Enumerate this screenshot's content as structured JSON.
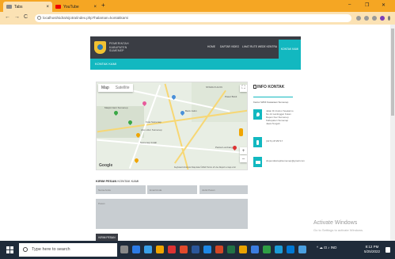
{
  "browser": {
    "tabs": [
      {
        "label": "Tabs",
        "active": true
      },
      {
        "label": "YouTube",
        "active": false
      }
    ],
    "new_tab": "+",
    "url": "localhost/sidra/sijotra/index.php?halaman=kontakkami",
    "window_controls": [
      "–",
      "❐",
      "✕"
    ]
  },
  "site": {
    "brand_lines": [
      "PEMERINTAH",
      "KABUPATEN",
      "SUMENEP"
    ],
    "nav": [
      "HOME",
      "DAFTAR VIDEO",
      "LIHAT RUTE WEDE KENTRA"
    ],
    "nav_cta": "KONTAK KAMI",
    "subtitle": "KONTAK KAMI"
  },
  "map": {
    "tab_map": "Map",
    "tab_satellite": "Satellite",
    "labels": [
      "STARA KULON",
      "Pasar Bukit",
      "Masjid Jami Sumenep",
      "Kota Sumenep",
      "Alun-Alun Sumenep",
      "Sumenep Indah",
      "Bank Jatim",
      "Pantai Lombang"
    ],
    "zoom_in": "+",
    "zoom_out": "–",
    "fullscreen": "⛶",
    "google": "Google",
    "attribution": "Keyboard shortcuts   Map data ©2022   Terms of Use   Report a map error"
  },
  "info": {
    "title": "INFO KONTAK",
    "description": "Kantor WIDI Kawaraan Sumenep",
    "address_lines": [
      "Jalan Dr.Insinur Soekarno",
      "No.14 Lantinggar Kotan",
      "Dapon Kec.Sumenep",
      "Kabupaten Sumenep",
      "Jawa Tengah"
    ],
    "phone": "(0271) 8725717",
    "email": "dispendukcapilsumenep@gmail.com"
  },
  "form": {
    "title_bold": "KIRIM PESAN",
    "title_rest": " KONTAK KAMI",
    "name_placeholder": "Nama Anda",
    "email_placeholder": "Email Anda",
    "subject_placeholder": "Judul Pesan",
    "message_placeholder": "Pesan",
    "send_label": "KIRIM PESAN"
  },
  "watermark": {
    "title": "Activate Windows",
    "subtitle": "Go to Settings to activate Windows."
  },
  "taskbar": {
    "search_placeholder": "Type here to search",
    "tray_text": "^ ☁ ⊡ ♪ IND",
    "time": "8:12 PM",
    "date": "5/25/2022"
  },
  "colors": {
    "accent": "#12b8c0",
    "header_dark": "#3a3d44",
    "browser_tab": "#f5a623"
  }
}
